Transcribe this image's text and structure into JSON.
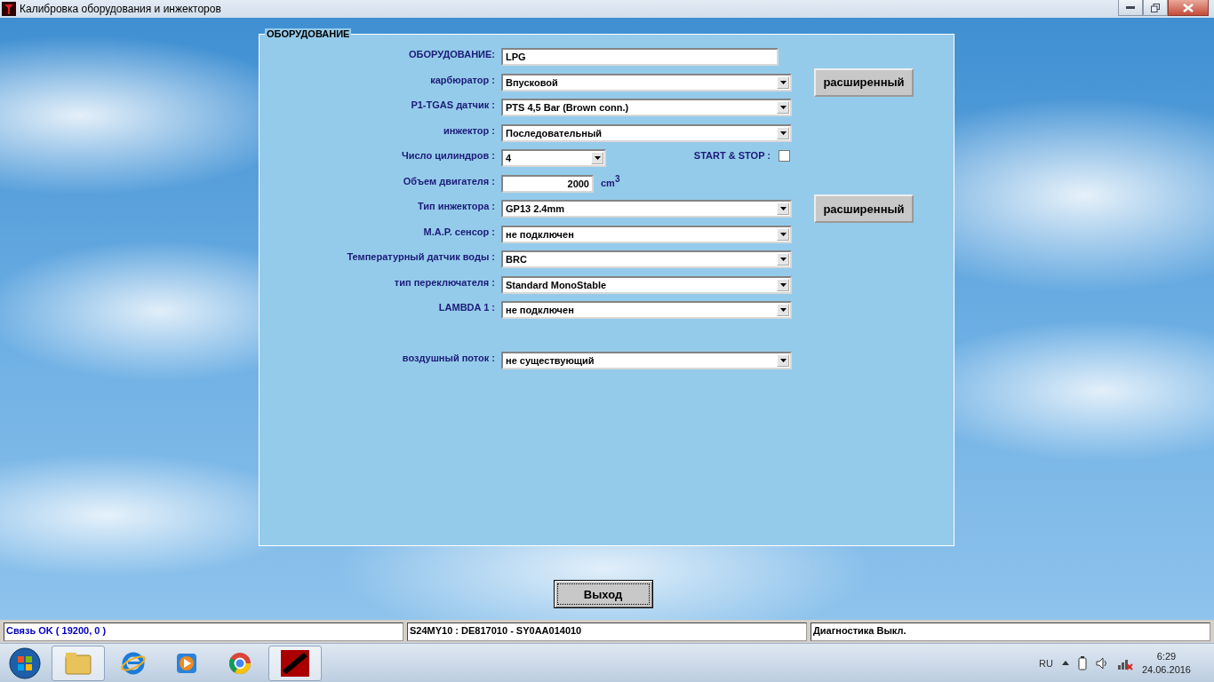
{
  "window": {
    "title": "Калибровка оборудования и инжекторов"
  },
  "panel": {
    "title": "ОБОРУДОВАНИЕ",
    "rows": [
      {
        "kind": "text",
        "label": "ОБОРУДОВАНИЕ:",
        "value": "LPG"
      },
      {
        "kind": "select",
        "label": "карбюратор :",
        "value": "Впусковой",
        "button": "расширенный"
      },
      {
        "kind": "select",
        "label": "P1-TGAS датчик :",
        "value": "PTS 4,5 Bar (Brown conn.)"
      },
      {
        "kind": "select",
        "label": "инжектор :",
        "value": "Последовательный"
      },
      {
        "kind": "short_select",
        "label": "Число цилиндров :",
        "value": "4",
        "checkbox": {
          "label": "START & STOP :",
          "checked": false
        }
      },
      {
        "kind": "number",
        "label": "Объем двигателя :",
        "value": "2000",
        "unit": "cm",
        "unit_sup": "3"
      },
      {
        "kind": "select",
        "label": "Тип инжектора :",
        "value": "GP13 2.4mm",
        "button": "расширенный"
      },
      {
        "kind": "select",
        "label": "M.A.P. сенсор :",
        "value": "не подключен"
      },
      {
        "kind": "select",
        "label": "Температурный датчик воды :",
        "value": "BRC"
      },
      {
        "kind": "select",
        "label": "тип переключателя :",
        "value": "Standard MonoStable"
      },
      {
        "kind": "select",
        "label": "LAMBDA 1 :",
        "value": "не подключен"
      }
    ],
    "lower_rows": [
      {
        "kind": "select",
        "label": "воздушный поток :",
        "value": "не существующий"
      }
    ]
  },
  "exit_button": "Выход",
  "status_bar": [
    "Связь OK ( 19200,  0 )",
    "S24MY10 : DE817010 - SY0AA014010",
    "Диагностика Выкл."
  ],
  "taskbar": {
    "language": "RU",
    "time": "6:29",
    "date": "24.06.2016"
  }
}
